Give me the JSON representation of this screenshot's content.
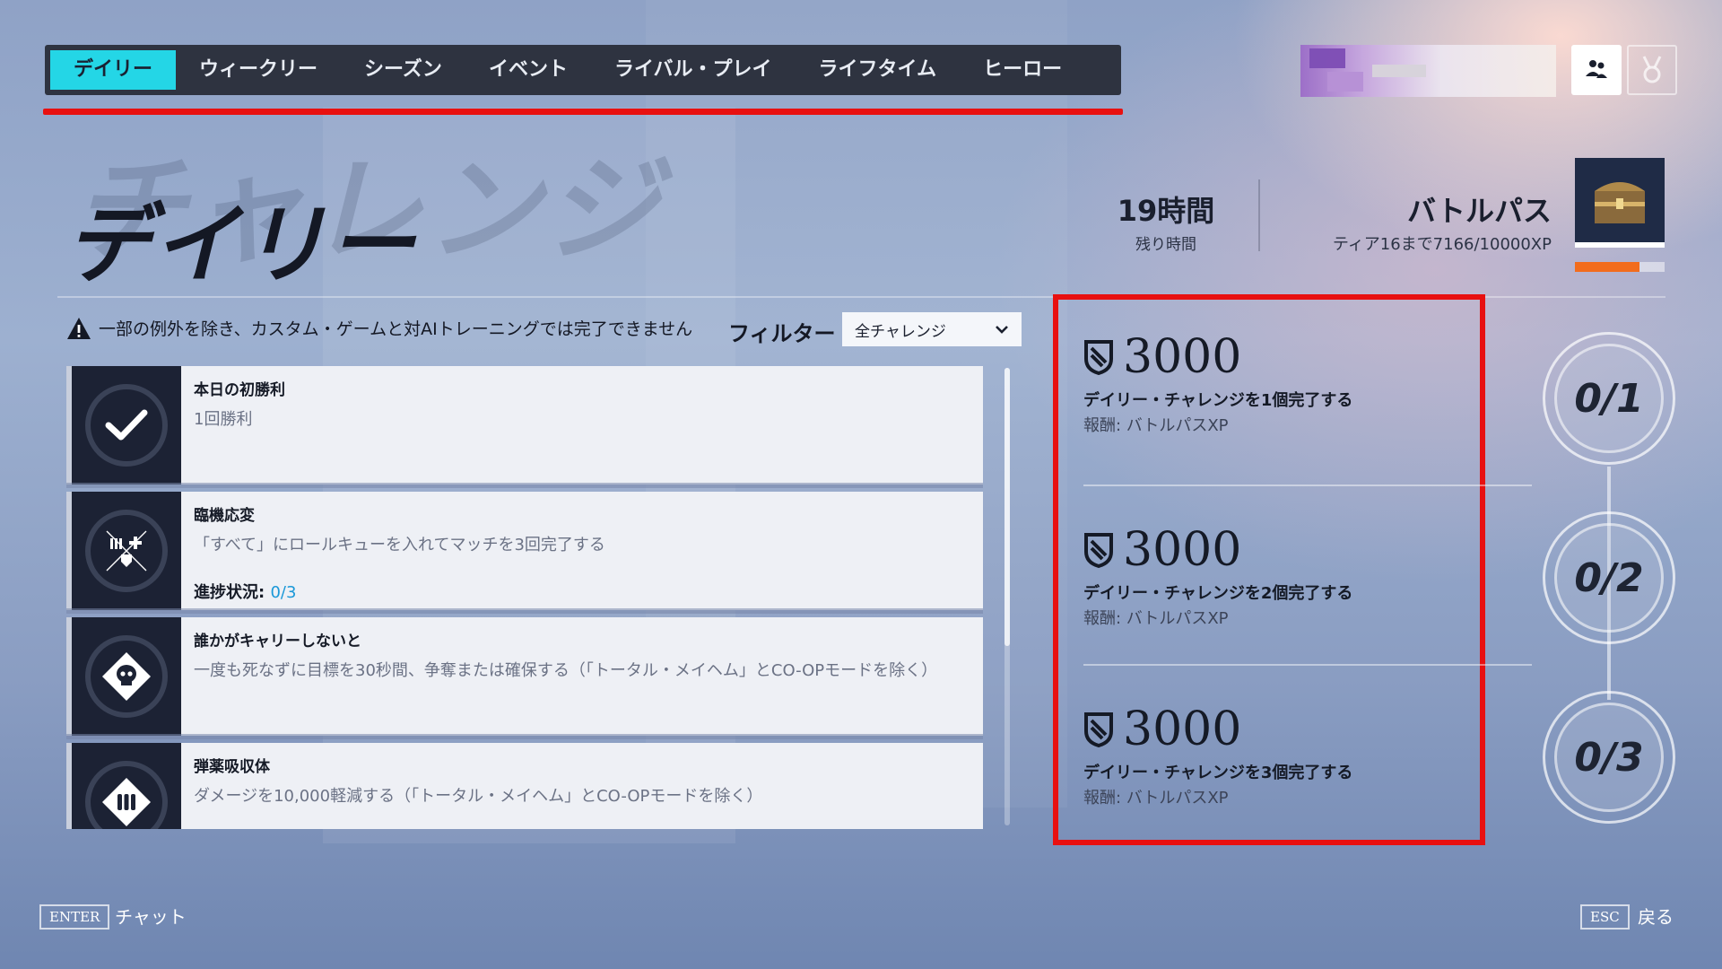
{
  "nav": {
    "tabs": [
      {
        "label": "デイリー",
        "active": true
      },
      {
        "label": "ウィークリー"
      },
      {
        "label": "シーズン"
      },
      {
        "label": "イベント"
      },
      {
        "label": "ライバル・プレイ"
      },
      {
        "label": "ライフタイム"
      },
      {
        "label": "ヒーロー"
      }
    ]
  },
  "header": {
    "title_bg": "チャレンジ",
    "title": "デイリー"
  },
  "time_remaining": {
    "value": "19時間",
    "label": "残り時間"
  },
  "battle_pass": {
    "title": "バトルパス",
    "progress_text": "ティア16まで7166/10000XP",
    "progress": 0.7166
  },
  "notice": {
    "warning": "一部の例外を除き、カスタム・ゲームと対AIトレーニングでは完了できません",
    "filter_label": "フィルター",
    "filter_value": "全チャレンジ"
  },
  "challenges": [
    {
      "name": "本日の初勝利",
      "desc": "1回勝利",
      "icon": "checkmark-icon"
    },
    {
      "name": "臨機応変",
      "desc": "「すべて」にロールキューを入れてマッチを3回完了する",
      "progress_label": "進捗状況:",
      "progress_value": "0/3",
      "icon": "role-queue-icon"
    },
    {
      "name": "誰かがキャリーしないと",
      "desc": "一度も死なずに目標を30秒間、争奪または確保する（「トータル・メイヘム」とCO-OPモードを除く）",
      "icon": "skull-icon"
    },
    {
      "name": "弾薬吸収体",
      "desc": "ダメージを10,000軽減する（「トータル・メイヘム」とCO-OPモードを除く）",
      "icon": "ammo-icon"
    }
  ],
  "rewards": [
    {
      "xp": "3000",
      "desc": "デイリー・チャレンジを1個完了する",
      "type": "報酬:  バトルパスXP",
      "milestone": "0/1"
    },
    {
      "xp": "3000",
      "desc": "デイリー・チャレンジを2個完了する",
      "type": "報酬:  バトルパスXP",
      "milestone": "0/2"
    },
    {
      "xp": "3000",
      "desc": "デイリー・チャレンジを3個完了する",
      "type": "報酬:  バトルパスXP",
      "milestone": "0/3"
    }
  ],
  "footer": {
    "enter_key": "ENTER",
    "enter_label": "チャット",
    "esc_key": "ESC",
    "esc_label": "戻る"
  },
  "colors": {
    "accent_tab": "#24d6e6",
    "highlight_red": "#e81010",
    "progress_orange": "#f26c1c",
    "progress_blue": "#1a98d8"
  }
}
